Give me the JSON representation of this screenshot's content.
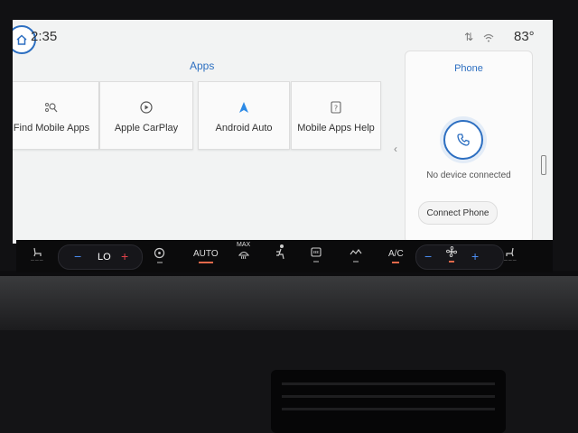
{
  "status_bar": {
    "time": "2:35",
    "temperature": "83°",
    "icons": [
      "sync-arrows-icon",
      "wifi-icon"
    ]
  },
  "apps": {
    "title": "Apps",
    "tiles": [
      {
        "label": "Find Mobile Apps",
        "icon": "search-apps-icon"
      },
      {
        "label": "Apple CarPlay",
        "icon": "play-circle-icon"
      },
      {
        "label": "Android Auto",
        "icon": "android-auto-icon"
      },
      {
        "label": "Mobile Apps Help",
        "icon": "help-box-icon"
      }
    ]
  },
  "phone": {
    "title": "Phone",
    "status": "No device connected",
    "connect_label": "Connect Phone"
  },
  "climate": {
    "driver_temp": "LO",
    "auto_label": "AUTO",
    "max_label": "MAX",
    "ac_label": "A/C"
  },
  "colors": {
    "accent": "#2d6fc1",
    "indicator": "#e2684a",
    "temp_minus": "#4c8ff5",
    "temp_plus": "#e2434a"
  }
}
